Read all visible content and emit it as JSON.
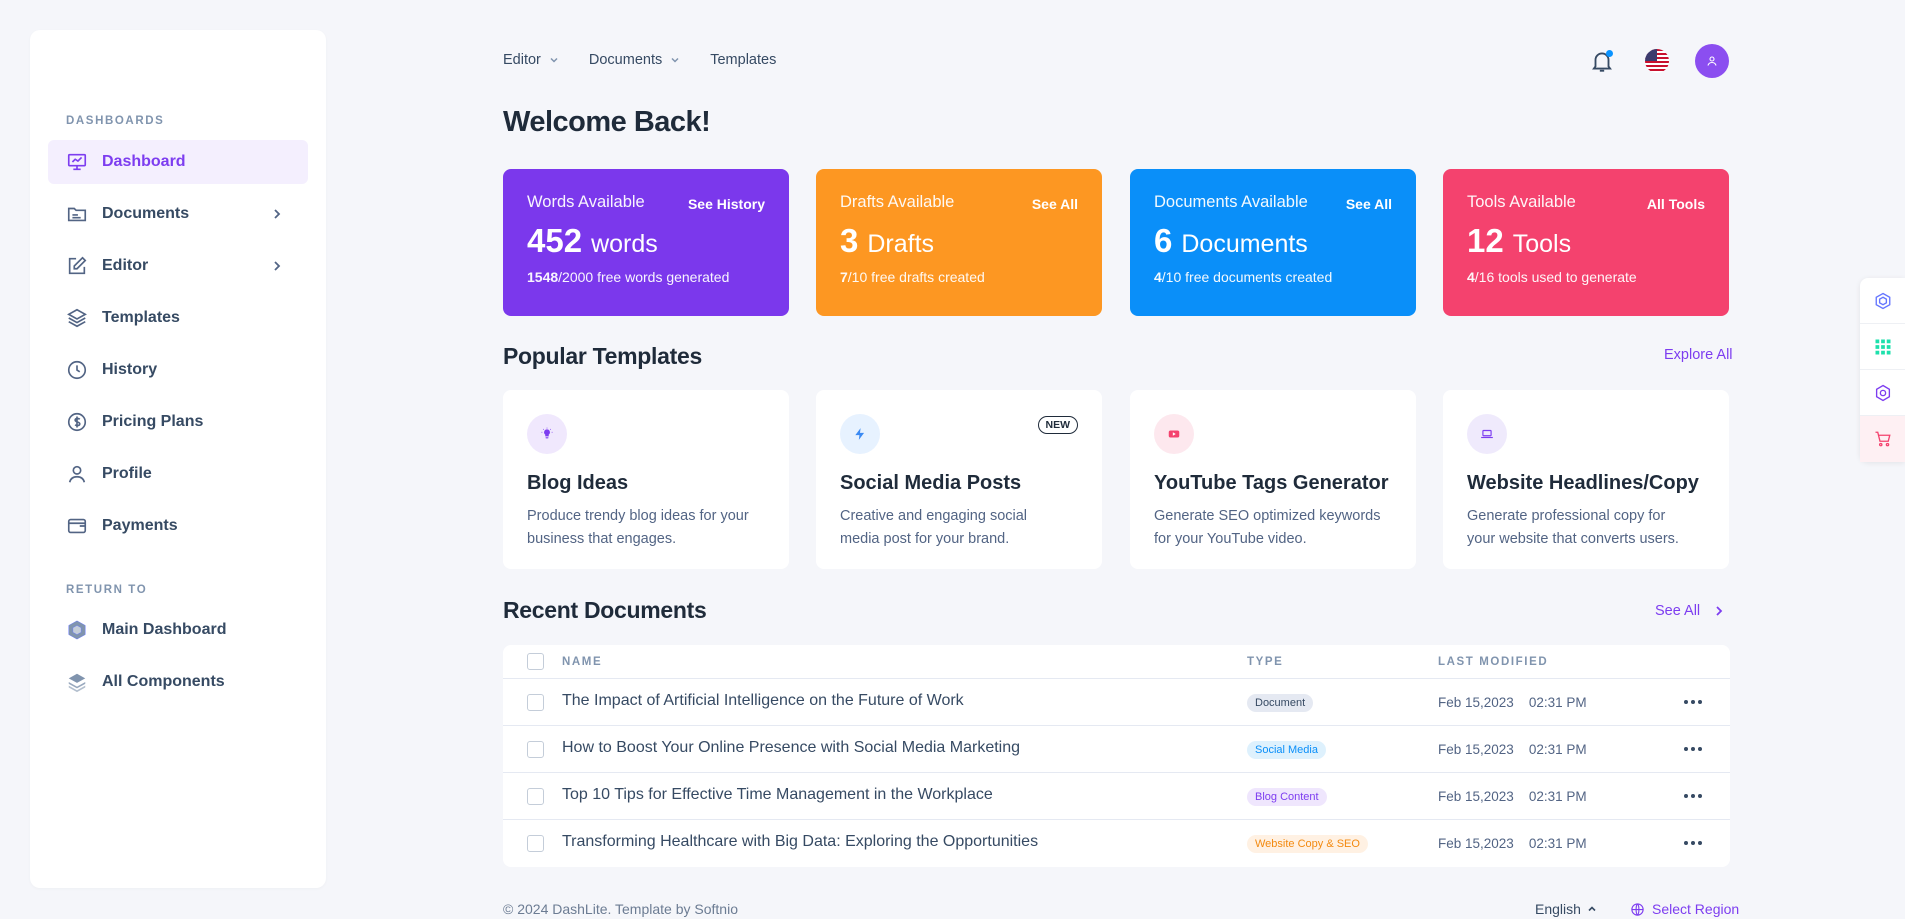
{
  "sidebar": {
    "sections": [
      {
        "heading": "DASHBOARDS"
      },
      {
        "heading": "RETURN TO"
      }
    ],
    "items": [
      {
        "label": "Dashboard",
        "icon": "presentation-icon"
      },
      {
        "label": "Documents",
        "icon": "folder-icon"
      },
      {
        "label": "Editor",
        "icon": "edit-icon"
      },
      {
        "label": "Templates",
        "icon": "layers-icon"
      },
      {
        "label": "History",
        "icon": "clock-icon"
      },
      {
        "label": "Pricing Plans",
        "icon": "dollar-icon"
      },
      {
        "label": "Profile",
        "icon": "user-icon"
      },
      {
        "label": "Payments",
        "icon": "wallet-icon"
      },
      {
        "label": "Main Dashboard",
        "icon": "hexagon-icon"
      },
      {
        "label": "All Components",
        "icon": "stack-icon"
      }
    ]
  },
  "topnav": {
    "items": [
      {
        "label": "Editor"
      },
      {
        "label": "Documents"
      },
      {
        "label": "Templates"
      }
    ]
  },
  "header": {
    "welcome": "Welcome Back!"
  },
  "stats": [
    {
      "title": "Words Available",
      "link": "See History",
      "num": "452",
      "unit": "words",
      "used": "1548",
      "rest": "/2000 free words generated",
      "color": "#7b38ec"
    },
    {
      "title": "Drafts Available",
      "link": "See All",
      "num": "3",
      "unit": "Drafts",
      "used": "7",
      "rest": "/10 free drafts created",
      "color": "#fd9722"
    },
    {
      "title": "Documents Available",
      "link": "See All",
      "num": "6",
      "unit": "Documents",
      "used": "4",
      "rest": "/10 free documents created",
      "color": "#0a8ff9"
    },
    {
      "title": "Tools Available",
      "link": "All Tools",
      "num": "12",
      "unit": "Tools",
      "used": "4",
      "rest": "/16 tools used to generate",
      "color": "#f4426e"
    }
  ],
  "popular": {
    "title": "Popular Templates",
    "link": "Explore All",
    "cards": [
      {
        "title": "Blog Ideas",
        "desc": "Produce trendy blog ideas for your business that engages.",
        "icon": "bulb-icon",
        "badge": ""
      },
      {
        "title": "Social Media Posts",
        "desc": "Creative and engaging social media post for your brand.",
        "icon": "bolt-icon",
        "badge": "NEW"
      },
      {
        "title": "YouTube Tags Generator",
        "desc": "Generate SEO optimized keywords for your YouTube video.",
        "icon": "youtube-icon",
        "badge": ""
      },
      {
        "title": "Website Headlines/Copy",
        "desc": "Generate professional copy for your website that converts users.",
        "icon": "laptop-icon",
        "badge": ""
      }
    ]
  },
  "recent": {
    "title": "Recent Documents",
    "link": "See All",
    "columns": {
      "name": "NAME",
      "type": "TYPE",
      "modified": "LAST MODIFIED"
    },
    "rows": [
      {
        "name": "The Impact of Artificial Intelligence on the Future of Work",
        "type": "Document",
        "date": "Feb 15,2023",
        "time": "02:31 PM"
      },
      {
        "name": "How to Boost Your Online Presence with Social Media Marketing",
        "type": "Social Media",
        "date": "Feb 15,2023",
        "time": "02:31 PM"
      },
      {
        "name": "Top 10 Tips for Effective Time Management in the Workplace",
        "type": "Blog Content",
        "date": "Feb 15,2023",
        "time": "02:31 PM"
      },
      {
        "name": "Transforming Healthcare with Big Data: Exploring the Opportunities",
        "type": "Website Copy & SEO",
        "date": "Feb 15,2023",
        "time": "02:31 PM"
      }
    ]
  },
  "footer": {
    "copyright": "© 2024 DashLite. Template by Softnio",
    "language": "English",
    "region": "Select Region"
  }
}
